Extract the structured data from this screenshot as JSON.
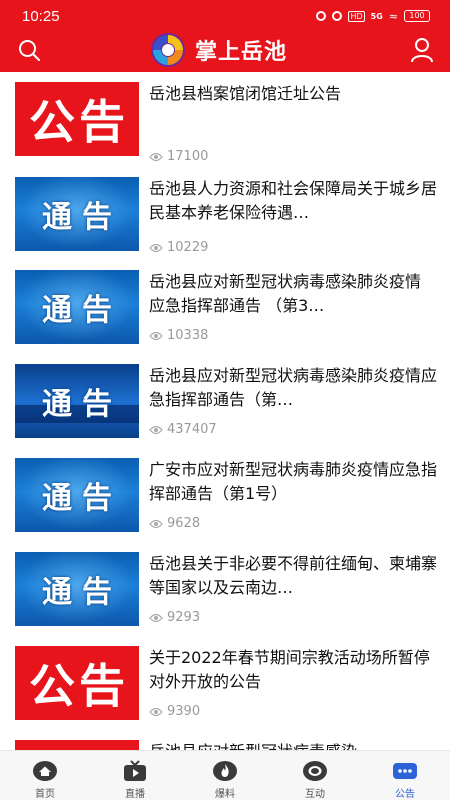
{
  "status_bar": {
    "time": "10:25",
    "hd": "HD",
    "network": "5G",
    "battery": "100"
  },
  "app": {
    "title": "掌上岳池"
  },
  "news": [
    {
      "thumb_text": "公告",
      "thumb_style": "red",
      "title": "岳池县档案馆闭馆迁址公告",
      "views": "17100"
    },
    {
      "thumb_text": "通告",
      "thumb_style": "blue",
      "title": "岳池县人力资源和社会保障局关于城乡居民基本养老保险待遇…",
      "views": "10229"
    },
    {
      "thumb_text": "通告",
      "thumb_style": "blue",
      "title": "岳池县应对新型冠状病毒感染肺炎疫情 应急指挥部通告 （第3…",
      "views": "10338"
    },
    {
      "thumb_text": "通告",
      "thumb_style": "darkblue",
      "title": "岳池县应对新型冠状病毒感染肺炎疫情应急指挥部通告（第…",
      "views": "437407"
    },
    {
      "thumb_text": "通告",
      "thumb_style": "blue",
      "title": "广安市应对新型冠状病毒肺炎疫情应急指挥部通告（第1号）",
      "views": "9628"
    },
    {
      "thumb_text": "通告",
      "thumb_style": "blue",
      "title": "岳池县关于非必要不得前往缅甸、柬埔寨等国家以及云南边…",
      "views": "9293"
    },
    {
      "thumb_text": "公告",
      "thumb_style": "red",
      "title": "关于2022年春节期间宗教活动场所暂停对外开放的公告",
      "views": "9390"
    },
    {
      "thumb_text": "公告",
      "thumb_style": "red",
      "title": "岳池县应对新型冠状病毒感染",
      "views": ""
    }
  ],
  "tabs": [
    {
      "label": "首页",
      "icon": "home-icon"
    },
    {
      "label": "直播",
      "icon": "tv-icon"
    },
    {
      "label": "爆料",
      "icon": "fire-icon"
    },
    {
      "label": "互动",
      "icon": "chat-bubble-icon"
    },
    {
      "label": "公告",
      "icon": "announcement-icon",
      "active": true
    }
  ],
  "colors": {
    "brand_red": "#e8141b",
    "active_tab": "#2c63d6",
    "muted": "#999999"
  }
}
